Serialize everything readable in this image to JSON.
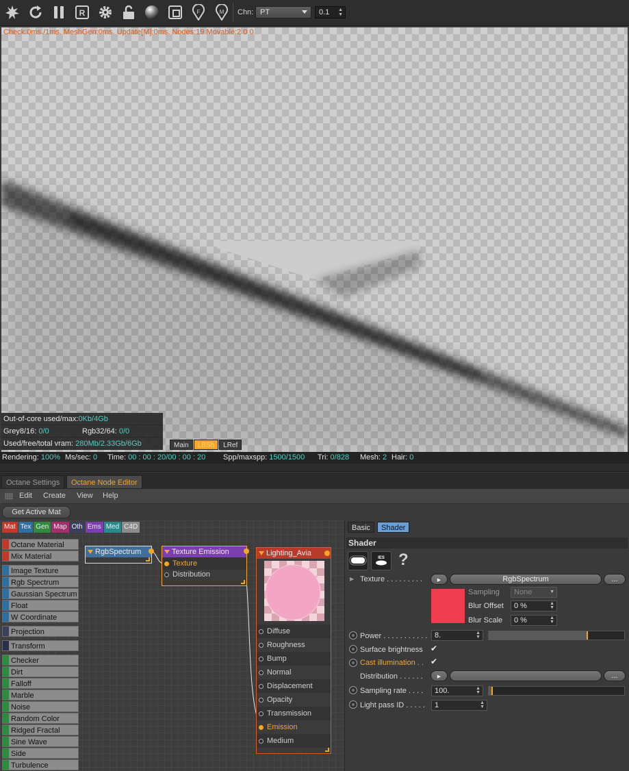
{
  "toolbar": {
    "icons": [
      "render-start-icon",
      "restart-icon",
      "pause-icon",
      "region-render-icon",
      "settings-gear-icon",
      "lock-icon",
      "material-sphere-icon",
      "region-box-icon",
      "focus-pin-icon",
      "material-pin-icon"
    ],
    "channel_label": "Chn:",
    "channel_value": "PT",
    "channel_number": "0.1"
  },
  "viewport": {
    "check_line": "Check:0ms./1ms. MeshGen:0ms. Update[M]:0ms. Nodes:19 Movable:2  0 0",
    "stats": {
      "outofcore_label": "Out-of-core used/max:",
      "outofcore_value": "0Kb/4Gb",
      "grey_label": "Grey8/16:",
      "grey_value": "0/0",
      "rgb_label": "Rgb32/64:",
      "rgb_value": "0/0",
      "vram_label": "Used/free/total vram:",
      "vram_value": "280Mb/2.33Gb/6Gb"
    },
    "tabs": [
      "Main",
      "LBSh",
      "LRef"
    ]
  },
  "status": {
    "rendering_label": "Rendering:",
    "rendering_value": "100%",
    "mssec_label": "Ms/sec:",
    "mssec_value": "0",
    "time_label": "Time:",
    "time_value": "00 : 00 : 20/00 : 00 : 20",
    "spp_label": "Spp/maxspp:",
    "spp_value": "1500/1500",
    "tri_label": "Tri:",
    "tri_value": "0/828",
    "mesh_label": "Mesh:",
    "mesh_value": "2",
    "hair_label": "Hair:",
    "hair_value": "0"
  },
  "panel_tabs": [
    "Octane Settings",
    "Octane Node Editor"
  ],
  "menu": [
    "Edit",
    "Create",
    "View",
    "Help"
  ],
  "get_active": "Get Active Mat",
  "categories": [
    {
      "label": "Mat",
      "color": "#c0392b"
    },
    {
      "label": "Tex",
      "color": "#2f6f9f"
    },
    {
      "label": "Gen",
      "color": "#2e8b3e"
    },
    {
      "label": "Map",
      "color": "#a0306a"
    },
    {
      "label": "Oth",
      "color": "#3a3f5c"
    },
    {
      "label": "Ems",
      "color": "#7b3fb0"
    },
    {
      "label": "Med",
      "color": "#2a8a8a"
    },
    {
      "label": "C4D",
      "color": "#8c8c8c"
    }
  ],
  "palette": {
    "mat": [
      "Octane Material",
      "Mix Material"
    ],
    "tex": [
      "Image Texture",
      "Rgb Spectrum",
      "Gaussian Spectrum",
      "Float",
      "W Coordinate"
    ],
    "proj": [
      "Projection"
    ],
    "trans": [
      "Transform"
    ],
    "gen": [
      "Checker",
      "Dirt",
      "Falloff",
      "Marble",
      "Noise",
      "Random Color",
      "Ridged Fractal",
      "Sine Wave",
      "Side",
      "Turbulence"
    ]
  },
  "nodes": {
    "rgb": {
      "title": "RgbSpectrum"
    },
    "texemit": {
      "title": "Texture Emission",
      "pins": [
        "Texture",
        "Distribution"
      ]
    },
    "light": {
      "title": "Lighting_Avia",
      "pins": [
        "Diffuse",
        "Roughness",
        "Bump",
        "Normal",
        "Displacement",
        "Opacity",
        "Transmission",
        "Emission",
        "Medium"
      ]
    }
  },
  "attributes": {
    "tabs": [
      "Basic",
      "Shader"
    ],
    "section": "Shader",
    "help": "?",
    "texture_label": "Texture . . . . . . . . .",
    "texture_value": "RgbSpectrum",
    "more": "...",
    "sampling_label": "Sampling",
    "sampling_value": "None",
    "blur_offset_label": "Blur Offset",
    "blur_offset_value": "0 %",
    "blur_scale_label": "Blur Scale",
    "blur_scale_value": "0 %",
    "swatch_color": "#ef3d4f",
    "power_label": "Power . . . . . . . . . . .",
    "power_value": "8.",
    "power_level": 0.72,
    "surface_label": "Surface brightness",
    "cast_label": "Cast illumination . .",
    "distribution_label": "Distribution . . . . . .",
    "sampling_rate_label": "Sampling rate . . . .",
    "sampling_rate_value": "100.",
    "sampling_rate_level": 0.02,
    "lightpass_label": "Light pass ID . . . . .",
    "lightpass_value": "1",
    "checkmark": "✔"
  }
}
